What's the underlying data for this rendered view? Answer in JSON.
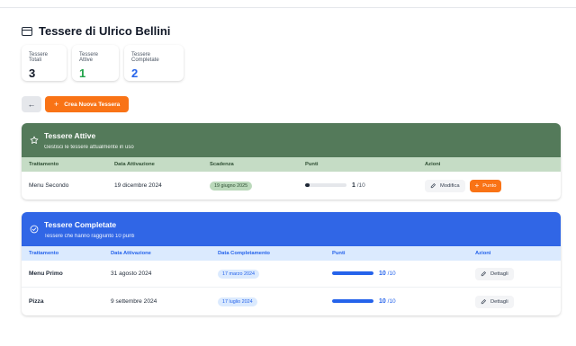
{
  "page": {
    "title": "Tessere di Ulrico Bellini"
  },
  "stats": [
    {
      "label": "Tessere Totali",
      "value": "3",
      "color": "#111827"
    },
    {
      "label": "Tessere Attive",
      "value": "1",
      "color": "#22a34a"
    },
    {
      "label": "Tessere Completate",
      "value": "2",
      "color": "#2563eb"
    }
  ],
  "toolbar": {
    "back_icon": "←",
    "create_label": "Crea Nuova Tessera",
    "create_icon": "+"
  },
  "active": {
    "title": "Tessere Attive",
    "subtitle": "Gestisci le tessere attualmente in uso",
    "colors": {
      "header": "#547a5a",
      "thead": "#c5dcc5"
    },
    "columns": [
      "Trattamento",
      "Data Attivazione",
      "Scadenza",
      "Punti",
      "Azioni"
    ],
    "rows": [
      {
        "treatment": "Menu Secondo",
        "activation": "19 dicembre 2024",
        "expiry": "19 giugno 2025",
        "points": "1",
        "points_total": "/10",
        "progress": 0.1,
        "edit_label": "Modifica",
        "points_label": "Punto"
      }
    ]
  },
  "completed": {
    "title": "Tessere Completate",
    "subtitle": "Tessere che hanno raggiunto 10 punti",
    "colors": {
      "header": "#3066e6",
      "thead": "#dbeafe"
    },
    "columns": [
      "Trattamento",
      "Data Attivazione",
      "Data Completamento",
      "Punti",
      "Azioni"
    ],
    "rows": [
      {
        "treatment": "Menu Primo",
        "activation": "31 agosto 2024",
        "completed": "17 marzo 2024",
        "points": "10",
        "points_total": "/10",
        "progress": 1.0,
        "details_label": "Dettagli"
      },
      {
        "treatment": "Pizza",
        "activation": "9 settembre 2024",
        "completed": "17 luglio 2024",
        "points": "10",
        "points_total": "/10",
        "progress": 1.0,
        "details_label": "Dettagli"
      }
    ]
  }
}
